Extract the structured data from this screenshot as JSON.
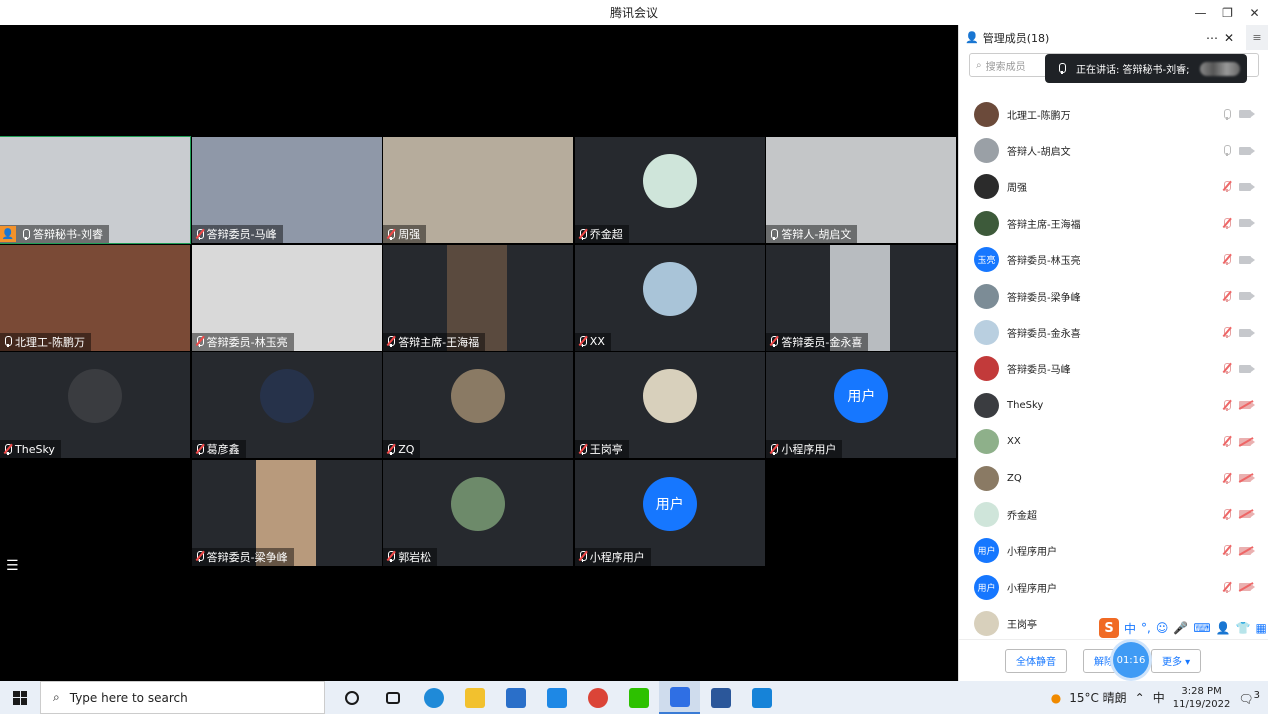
{
  "window": {
    "title": "腾讯会议",
    "controls": [
      "—",
      "❐",
      "✕"
    ]
  },
  "grid": [
    {
      "name": "答辩秘书-刘睿",
      "kind": "cam",
      "cam_color": "#c9ccd0",
      "active": true,
      "host": true,
      "muted": false
    },
    {
      "name": "答辩委员-马峰",
      "kind": "cam",
      "cam_color": "#8f98a8",
      "active": false,
      "host": false,
      "muted": true
    },
    {
      "name": "周强",
      "kind": "cam",
      "cam_color": "#b6ac9c",
      "active": false,
      "host": false,
      "muted": true
    },
    {
      "name": "乔金超",
      "kind": "avatar",
      "avatar_color": "#cfe5da",
      "active": false,
      "host": false,
      "muted": true
    },
    {
      "name": "答辩人-胡启文",
      "kind": "cam",
      "cam_color": "#c4c6c8",
      "active": false,
      "host": false,
      "muted": false
    },
    {
      "name": "北理工-陈鹏万",
      "kind": "cam",
      "cam_color": "#7a4a36",
      "active": false,
      "host": false,
      "muted": false
    },
    {
      "name": "答辩委员-林玉亮",
      "kind": "cam",
      "cam_color": "#d9d9d9",
      "active": false,
      "host": false,
      "muted": true
    },
    {
      "name": "答辩主席-王海福",
      "kind": "cam-narrow",
      "cam_color": "#5a4a3e",
      "active": false,
      "host": false,
      "muted": true
    },
    {
      "name": "XX",
      "kind": "avatar",
      "avatar_color": "#a9c4d8",
      "active": false,
      "host": false,
      "muted": true
    },
    {
      "name": "答辩委员-金永喜",
      "kind": "cam-narrow",
      "cam_color": "#b8bcc0",
      "active": false,
      "host": false,
      "muted": true
    },
    {
      "name": "TheSky",
      "kind": "avatar",
      "avatar_color": "#3a3c40",
      "active": false,
      "host": false,
      "muted": true
    },
    {
      "name": "葛彦鑫",
      "kind": "avatar",
      "avatar_color": "#26324a",
      "active": false,
      "host": false,
      "muted": true
    },
    {
      "name": "ZQ",
      "kind": "avatar",
      "avatar_color": "#8a7a64",
      "active": false,
      "host": false,
      "muted": true
    },
    {
      "name": "王岗亭",
      "kind": "avatar",
      "avatar_color": "#d8d0bc",
      "active": false,
      "host": false,
      "muted": true
    },
    {
      "name": "小程序用户",
      "kind": "user",
      "avatar_text": "用户",
      "active": false,
      "host": false,
      "muted": true
    },
    {
      "name": "",
      "kind": "empty",
      "active": false,
      "host": false,
      "muted": false
    },
    {
      "name": "答辩委员-梁争峰",
      "kind": "cam-narrow",
      "cam_color": "#b89a7c",
      "active": false,
      "host": false,
      "muted": true
    },
    {
      "name": "郭岩松",
      "kind": "avatar",
      "avatar_color": "#6d8a6a",
      "active": false,
      "host": false,
      "muted": true
    },
    {
      "name": "小程序用户",
      "kind": "user",
      "avatar_text": "用户",
      "active": false,
      "host": false,
      "muted": true
    }
  ],
  "host_badge_icon": "user-icon",
  "list_button_icon": "list-icon",
  "panel": {
    "title": "管理成员(18)",
    "more_icon": "more-icon",
    "close_icon": "close-icon",
    "side_icon": "menu-icon",
    "search_placeholder": "搜索成员",
    "speaking_label": "正在讲话: 答辩秘书-刘睿;",
    "members": [
      {
        "name": "北理工-陈鹏万",
        "avatar_color": "#6b4a3a",
        "avatar_text": "",
        "muted": false,
        "video_off": false
      },
      {
        "name": "答辩人-胡启文",
        "avatar_color": "#9aa0a6",
        "avatar_text": "",
        "muted": false,
        "video_off": false
      },
      {
        "name": "周强",
        "avatar_color": "#2b2b2b",
        "avatar_text": "",
        "muted": true,
        "video_off": false
      },
      {
        "name": "答辩主席-王海福",
        "avatar_color": "#3d5a3a",
        "avatar_text": "",
        "muted": true,
        "video_off": false
      },
      {
        "name": "答辩委员-林玉亮",
        "avatar_color": "#1677ff",
        "avatar_text": "玉亮",
        "muted": true,
        "video_off": false
      },
      {
        "name": "答辩委员-梁争峰",
        "avatar_color": "#7c8c96",
        "avatar_text": "",
        "muted": true,
        "video_off": false
      },
      {
        "name": "答辩委员-金永喜",
        "avatar_color": "#b9cfe0",
        "avatar_text": "",
        "muted": true,
        "video_off": false
      },
      {
        "name": "答辩委员-马峰",
        "avatar_color": "#c23a3a",
        "avatar_text": "",
        "muted": true,
        "video_off": false
      },
      {
        "name": "TheSky",
        "avatar_color": "#3a3c40",
        "avatar_text": "",
        "muted": true,
        "video_off": true
      },
      {
        "name": "XX",
        "avatar_color": "#8eb08a",
        "avatar_text": "",
        "muted": true,
        "video_off": true
      },
      {
        "name": "ZQ",
        "avatar_color": "#8a7a64",
        "avatar_text": "",
        "muted": true,
        "video_off": true
      },
      {
        "name": "乔金超",
        "avatar_color": "#cfe5da",
        "avatar_text": "",
        "muted": true,
        "video_off": true
      },
      {
        "name": "小程序用户",
        "avatar_color": "#1677ff",
        "avatar_text": "用户",
        "muted": true,
        "video_off": true
      },
      {
        "name": "小程序用户",
        "avatar_color": "#1677ff",
        "avatar_text": "用户",
        "muted": true,
        "video_off": true
      },
      {
        "name": "王岗亭",
        "avatar_color": "#d8d0bc",
        "avatar_text": "",
        "muted": true,
        "video_off": true
      }
    ],
    "ime_logo": "S",
    "ime_items": [
      "中",
      "°,",
      "☺",
      "🎤",
      "⌨",
      "👤",
      "👕",
      "▦"
    ],
    "footer": {
      "mute_all": "全体静音",
      "unmute_all": "解除全",
      "timer": "01:16",
      "more": "更多 ▾"
    }
  },
  "taskbar": {
    "search_placeholder": "Type here to search",
    "apps": [
      {
        "name": "cortana",
        "color": "#1a1a1a",
        "active": false
      },
      {
        "name": "task-view",
        "color": "#1a1a1a",
        "active": false
      },
      {
        "name": "edge",
        "color": "#1f8ad8",
        "active": false
      },
      {
        "name": "file-explorer",
        "color": "#f2c12e",
        "active": false
      },
      {
        "name": "mail",
        "color": "#2a6fc9",
        "active": false
      },
      {
        "name": "app-l",
        "color": "#1e88e5",
        "active": false
      },
      {
        "name": "chrome",
        "color": "#db4437",
        "active": false
      },
      {
        "name": "wechat",
        "color": "#2dc100",
        "active": false
      },
      {
        "name": "tencent-meeting",
        "color": "#2f6fe4",
        "active": true
      },
      {
        "name": "word",
        "color": "#2b579a",
        "active": false
      },
      {
        "name": "photos",
        "color": "#1683d8",
        "active": false
      }
    ],
    "weather": "15°C  晴朗",
    "lang": "中",
    "time": "3:28 PM",
    "date": "11/19/2022",
    "notifications": "3"
  }
}
